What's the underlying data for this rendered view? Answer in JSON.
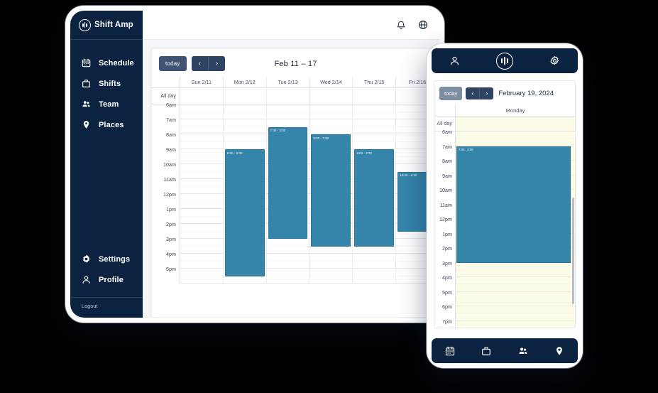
{
  "desktop": {
    "brand": "Shift Amp",
    "topbar": {
      "icons": [
        "bell-icon",
        "globe-icon"
      ]
    },
    "sidebar": {
      "items": [
        {
          "label": "Schedule",
          "icon": "calendar-icon"
        },
        {
          "label": "Shifts",
          "icon": "briefcase-icon"
        },
        {
          "label": "Team",
          "icon": "people-icon"
        },
        {
          "label": "Places",
          "icon": "location-pin-icon"
        }
      ],
      "bottom_items": [
        {
          "label": "Settings",
          "icon": "gear-icon"
        },
        {
          "label": "Profile",
          "icon": "person-icon"
        }
      ],
      "logout": "Logout"
    },
    "calendar": {
      "today_label": "today",
      "prev_label": "‹",
      "next_label": "›",
      "title": "Feb 11 – 17",
      "all_day_label": "All day",
      "columns": [
        "Sun 2/11",
        "Mon 2/12",
        "Tue 2/13",
        "Wed 2/14",
        "Thu 2/15",
        "Fri 2/16"
      ],
      "time_labels": [
        "6am",
        "7am",
        "8am",
        "9am",
        "10am",
        "11am",
        "12pm",
        "1pm",
        "2pm",
        "3pm",
        "4pm",
        "5pm"
      ],
      "events": [
        {
          "column": 1,
          "label": "9:00 - 5:30",
          "start": "9:00",
          "end": "17:30"
        },
        {
          "column": 2,
          "label": "7:30 - 3:00",
          "start": "7:30",
          "end": "15:00"
        },
        {
          "column": 3,
          "label": "8:00 - 3:30",
          "start": "8:00",
          "end": "15:30"
        },
        {
          "column": 4,
          "label": "9:00 - 3:30",
          "start": "9:00",
          "end": "15:30"
        },
        {
          "column": 5,
          "label": "10:30 - 2:30",
          "start": "10:30",
          "end": "14:30"
        }
      ]
    }
  },
  "tablet": {
    "header_icons": [
      "person-icon",
      "app-logo-icon",
      "gear-icon"
    ],
    "calendar": {
      "today_label": "today",
      "prev_label": "‹",
      "next_label": "›",
      "title": "February 19, 2024",
      "all_day_label": "All day",
      "day_column": "Monday",
      "time_labels": [
        "6am",
        "7am",
        "8am",
        "9am",
        "10am",
        "11am",
        "12pm",
        "1pm",
        "2pm",
        "3pm",
        "4pm",
        "5pm",
        "6pm",
        "7pm"
      ],
      "event": {
        "label": "7:00 - 3:00",
        "start": "7:00",
        "end": "15:00"
      }
    },
    "bottom_nav": [
      {
        "icon": "calendar-icon"
      },
      {
        "icon": "briefcase-icon"
      },
      {
        "icon": "people-icon"
      },
      {
        "icon": "location-pin-icon"
      }
    ]
  },
  "colors": {
    "navy": "#0b2340",
    "event_blue": "#3585ab",
    "toolbar_dark": "#2d4463",
    "tablet_cream": "#fbfbe8"
  }
}
